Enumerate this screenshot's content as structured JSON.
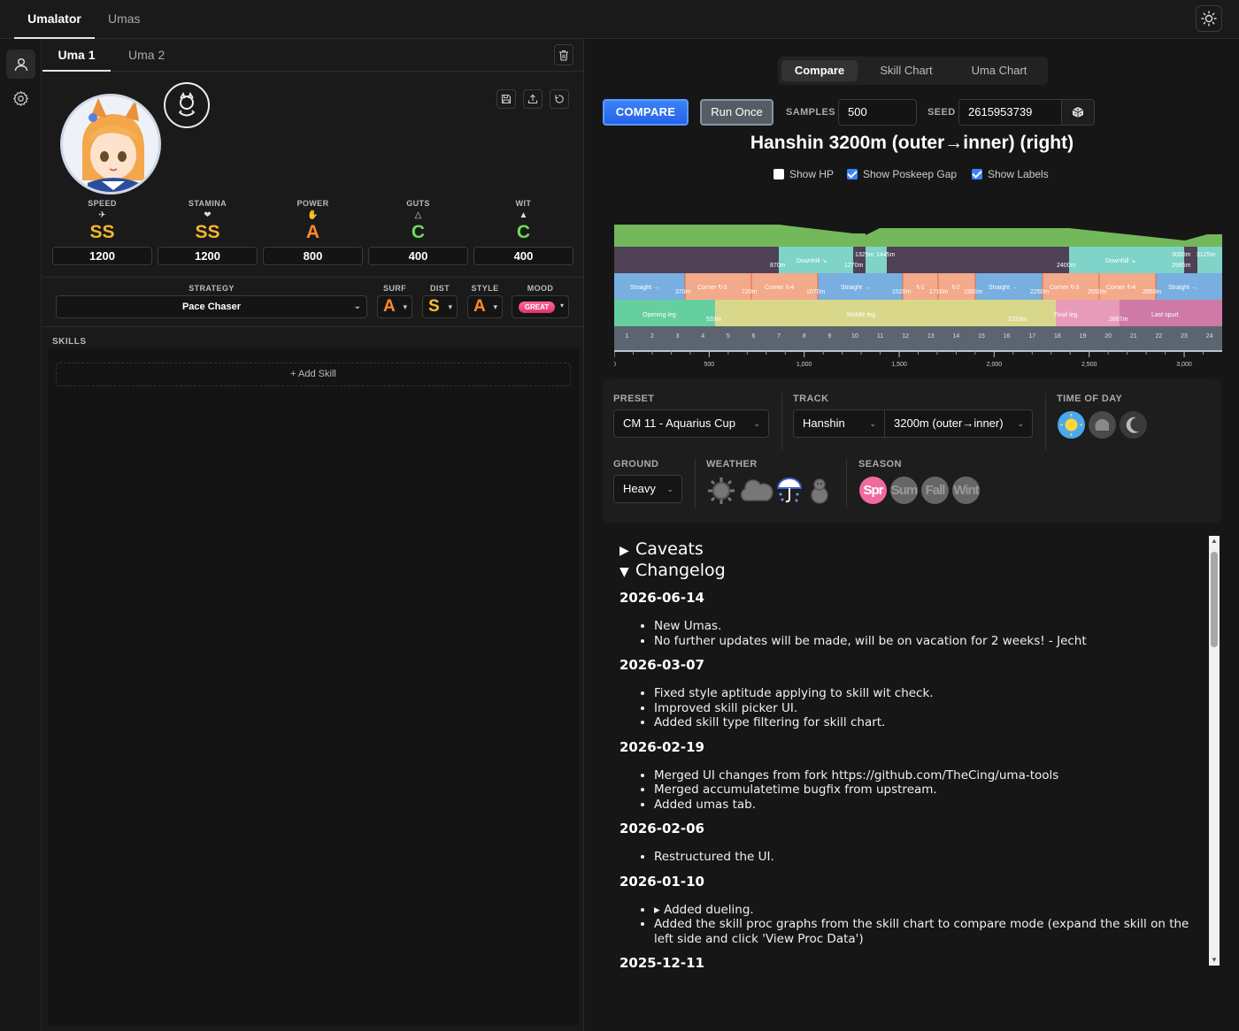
{
  "app": {
    "tabs": [
      {
        "label": "Umalator"
      },
      {
        "label": "Umas"
      }
    ],
    "theme_icon": "sun-icon"
  },
  "sidebar": {
    "items": [
      {
        "icon": "user-icon"
      },
      {
        "icon": "gear-icon"
      }
    ]
  },
  "left": {
    "uma_tabs": [
      {
        "label": "Uma 1"
      },
      {
        "label": "Uma 2"
      }
    ],
    "stats": [
      {
        "label": "SPEED",
        "grade": "SS",
        "value": "1200",
        "color": "#f5b52c"
      },
      {
        "label": "STAMINA",
        "grade": "SS",
        "value": "1200",
        "color": "#f5b52c"
      },
      {
        "label": "POWER",
        "grade": "A",
        "value": "800",
        "color": "#ff8a2a"
      },
      {
        "label": "GUTS",
        "grade": "C",
        "value": "400",
        "color": "#6edb5a"
      },
      {
        "label": "WIT",
        "grade": "C",
        "value": "400",
        "color": "#6edb5a"
      }
    ],
    "strategy_label": "STRATEGY",
    "strategy_value": "Pace Chaser",
    "aptitudes": [
      {
        "label": "SURF",
        "grade": "A",
        "color": "#ff8a2a"
      },
      {
        "label": "DIST",
        "grade": "S",
        "color": "#f5c02c"
      },
      {
        "label": "STYLE",
        "grade": "A",
        "color": "#ff8a2a"
      }
    ],
    "mood_label": "MOOD",
    "mood_value": "GREAT",
    "skills_label": "SKILLS",
    "add_skill": "+ Add Skill"
  },
  "right": {
    "mode_tabs": [
      {
        "label": "Compare"
      },
      {
        "label": "Skill Chart"
      },
      {
        "label": "Uma Chart"
      }
    ],
    "compare_btn": "COMPARE",
    "run_once_btn": "Run Once",
    "samples_label": "SAMPLES",
    "samples_value": "500",
    "seed_label": "SEED",
    "seed_value": "2615953739",
    "race_title": "Hanshin 3200m (outer→inner) (right)",
    "checkboxes": [
      {
        "label": "Show HP",
        "checked": false
      },
      {
        "label": "Show Poskeep Gap",
        "checked": true
      },
      {
        "label": "Show Labels",
        "checked": true
      }
    ],
    "preset_label": "PRESET",
    "preset_value": "CM 11 - Aquarius Cup",
    "track_label": "TRACK",
    "track_course": "Hanshin",
    "track_distance": "3200m (outer→inner)",
    "time_label": "TIME OF DAY",
    "ground_label": "GROUND",
    "ground_value": "Heavy",
    "weather_label": "WEATHER",
    "season_label": "SEASON",
    "seasons": [
      {
        "label": "Spr",
        "active": true,
        "color": "#f06aa0"
      },
      {
        "label": "Sum",
        "active": false,
        "color": "#666"
      },
      {
        "label": "Fall",
        "active": false,
        "color": "#666"
      },
      {
        "label": "Wint",
        "active": false,
        "color": "#666"
      }
    ],
    "caveats": "Caveats",
    "changelog": "Changelog",
    "entries": [
      {
        "date": "2026-06-14",
        "items": [
          "New Umas.",
          "No further updates will be made, will be on vacation for 2 weeks! - Jecht"
        ]
      },
      {
        "date": "2026-03-07",
        "items": [
          "Fixed style aptitude applying to skill wit check.",
          "Improved skill picker UI.",
          "Added skill type filtering for skill chart."
        ]
      },
      {
        "date": "2026-02-19",
        "items": [
          "Merged UI changes from fork https://github.com/TheCing/uma-tools",
          "Merged accumulatetime bugfix from upstream.",
          "Added umas tab."
        ]
      },
      {
        "date": "2026-02-06",
        "items": [
          "Restructured the UI."
        ]
      },
      {
        "date": "2026-01-10",
        "items": [
          "▸ Added dueling.",
          "Added the skill proc graphs from the skill chart to compare mode (expand the skill on the left side and click 'View Proc Data')"
        ]
      },
      {
        "date": "2025-12-11",
        "items": []
      }
    ]
  },
  "course_chart": {
    "slope_labels": [
      "870m",
      "Downhill ↘",
      "1270m",
      "1325m",
      "1445m",
      "2400m",
      "Downhill ↘",
      "2995m",
      "3000m",
      "3125m"
    ],
    "straight_corner_labels": [
      "Straight →",
      "370m",
      "Corner ↻3",
      "720m",
      "Corner ↻4",
      "1070m",
      "Straight →",
      "1520m",
      "↻1",
      "1710m",
      "↻2",
      "1900m",
      "Straight →",
      "2250m",
      "Corner ↻3",
      "2550m",
      "Corner ↻4",
      "2850m",
      "Straight →"
    ],
    "phase_labels": [
      "Opening leg",
      "533m",
      "Middle leg",
      "2333m",
      "Final leg",
      "2667m",
      "Last spurt"
    ],
    "sections": [
      "1",
      "2",
      "3",
      "4",
      "5",
      "6",
      "7",
      "8",
      "9",
      "10",
      "11",
      "12",
      "13",
      "14",
      "15",
      "16",
      "17",
      "18",
      "19",
      "20",
      "21",
      "22",
      "23",
      "24"
    ],
    "axis_ticks": [
      "0",
      "500",
      "1,000",
      "1,500",
      "2,000",
      "2,500",
      "3,000"
    ]
  }
}
